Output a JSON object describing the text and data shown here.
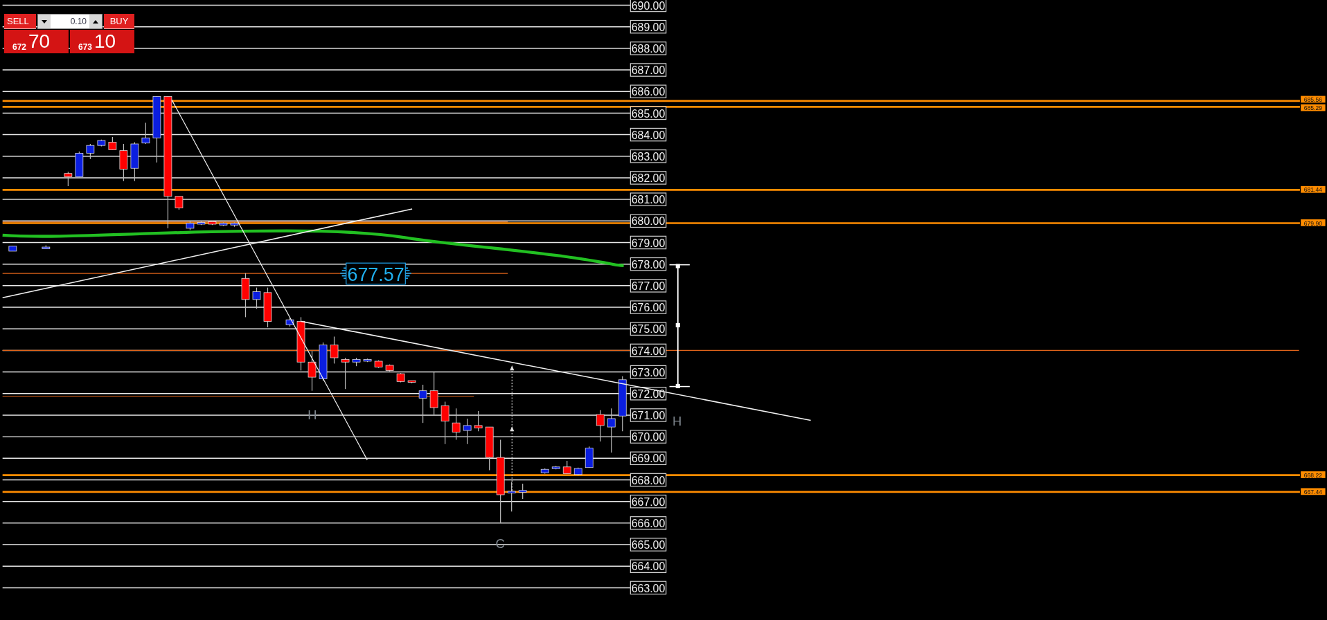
{
  "trade_panel": {
    "sell_label": "SELL",
    "buy_label": "BUY",
    "lot_size": "0.10",
    "sell_price_main": "672",
    "sell_price_big": "70",
    "buy_price_main": "673",
    "buy_price_big": "10"
  },
  "level_lines": [
    {
      "label": "685.56"
    },
    {
      "label": "685.29"
    },
    {
      "label": "681.44"
    },
    {
      "label": "679.90"
    },
    {
      "label": "668.22"
    },
    {
      "label": "667.44"
    }
  ],
  "current_price_tag": "677.57",
  "price_chart": {
    "chart_data": {
      "type": "candlestick",
      "ylim": [
        663,
        690
      ],
      "yticks": [
        {
          "value": 690,
          "label": "690.00"
        },
        {
          "value": 689,
          "label": "689.00"
        },
        {
          "value": 688,
          "label": "688.00"
        },
        {
          "value": 687,
          "label": "687.00"
        },
        {
          "value": 686,
          "label": "686.00"
        },
        {
          "value": 685,
          "label": "685.00"
        },
        {
          "value": 684,
          "label": "684.00"
        },
        {
          "value": 683,
          "label": "683.00"
        },
        {
          "value": 682,
          "label": "682.00"
        },
        {
          "value": 681,
          "label": "681.00"
        },
        {
          "value": 680,
          "label": "680.00"
        },
        {
          "value": 679,
          "label": "679.00"
        },
        {
          "value": 678,
          "label": "678.00"
        },
        {
          "value": 677,
          "label": "677.00"
        },
        {
          "value": 676,
          "label": "676.00"
        },
        {
          "value": 675,
          "label": "675.00"
        },
        {
          "value": 674,
          "label": "674.00"
        },
        {
          "value": 673,
          "label": "673.00"
        },
        {
          "value": 672,
          "label": "672.00"
        },
        {
          "value": 671,
          "label": "671.00"
        },
        {
          "value": 670,
          "label": "670.00"
        },
        {
          "value": 669,
          "label": "669.00"
        },
        {
          "value": 668,
          "label": "668.00"
        },
        {
          "value": 667,
          "label": "667.00"
        },
        {
          "value": 666,
          "label": "666.00"
        },
        {
          "value": 665,
          "label": "665.00"
        },
        {
          "value": 664,
          "label": "664.00"
        },
        {
          "value": 663,
          "label": "663.00"
        }
      ],
      "ohlc": [
        [
          678.6,
          678.83,
          678.6,
          678.83
        ],
        null,
        null,
        [
          678.75,
          678.87,
          678.71,
          678.79
        ],
        null,
        [
          682.2,
          682.28,
          681.61,
          682.05
        ],
        [
          682.05,
          683.22,
          682.05,
          683.14
        ],
        [
          683.14,
          683.57,
          682.87,
          683.5
        ],
        [
          683.5,
          683.77,
          683.46,
          683.73
        ],
        [
          683.65,
          683.89,
          683.3,
          683.3
        ],
        [
          683.26,
          683.57,
          681.85,
          682.4
        ],
        [
          682.44,
          683.65,
          681.85,
          683.57
        ],
        [
          683.61,
          684.55,
          683.57,
          683.85
        ],
        [
          683.85,
          685.77,
          682.71,
          685.77
        ],
        [
          685.77,
          685.77,
          679.66,
          681.14
        ],
        [
          681.14,
          681.14,
          680.52,
          680.6
        ],
        [
          679.66,
          679.97,
          679.58,
          679.89
        ],
        [
          679.85,
          679.97,
          679.81,
          679.93
        ],
        [
          679.97,
          680.01,
          679.81,
          679.85
        ],
        [
          679.81,
          679.93,
          679.77,
          679.89
        ],
        [
          679.81,
          679.93,
          679.73,
          679.89
        ],
        [
          677.34,
          677.58,
          675.54,
          676.36
        ],
        [
          676.36,
          676.91,
          675.93,
          676.72
        ],
        [
          676.68,
          676.91,
          675.07,
          675.34
        ],
        null,
        [
          675.19,
          675.5,
          675.11,
          675.42
        ],
        [
          675.34,
          675.54,
          673.07,
          673.46
        ],
        [
          673.46,
          673.97,
          672.13,
          672.76
        ],
        [
          672.68,
          674.37,
          672.6,
          674.25
        ],
        [
          674.25,
          674.64,
          673.39,
          673.66
        ],
        [
          673.58,
          673.66,
          672.21,
          673.46
        ],
        [
          673.46,
          673.66,
          673.27,
          673.58
        ],
        [
          673.5,
          673.62,
          673.46,
          673.58
        ],
        [
          673.5,
          673.54,
          673.19,
          673.23
        ],
        [
          673.31,
          673.35,
          673.03,
          673.07
        ],
        [
          672.92,
          672.95,
          672.52,
          672.56
        ],
        [
          672.6,
          672.6,
          672.48,
          672.52
        ],
        [
          671.78,
          672.41,
          670.64,
          672.13
        ],
        [
          672.13,
          672.99,
          671.03,
          671.35
        ],
        [
          671.43,
          671.62,
          669.66,
          670.72
        ],
        [
          670.64,
          671.31,
          669.86,
          670.21
        ],
        [
          670.29,
          670.84,
          669.66,
          670.52
        ],
        [
          670.52,
          671.19,
          670.25,
          670.4
        ],
        [
          670.45,
          670.45,
          668.45,
          669.04
        ],
        [
          669.04,
          669.86,
          666.02,
          667.31
        ],
        [
          667.39,
          667.9,
          666.53,
          667.47
        ],
        [
          667.43,
          667.82,
          667.12,
          667.51
        ],
        null,
        [
          668.33,
          668.53,
          668.29,
          668.49
        ],
        [
          668.53,
          668.64,
          668.49,
          668.6
        ],
        [
          668.6,
          668.88,
          668.29,
          668.29
        ],
        [
          668.25,
          668.57,
          668.21,
          668.53
        ],
        [
          668.57,
          669.55,
          668.57,
          669.47
        ],
        [
          671.03,
          671.23,
          669.78,
          670.52
        ],
        [
          670.45,
          671.31,
          669.27,
          670.84
        ],
        [
          670.96,
          672.8,
          670.25,
          672.64
        ]
      ]
    }
  },
  "pattern_labels": [
    {
      "text": "H"
    },
    {
      "text": "H"
    },
    {
      "text": "C"
    }
  ]
}
